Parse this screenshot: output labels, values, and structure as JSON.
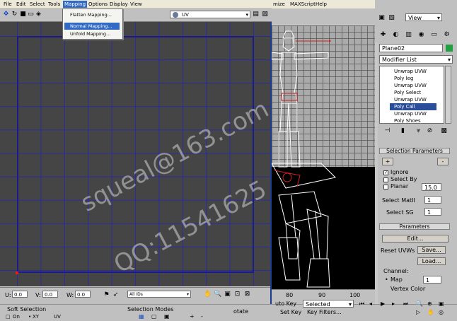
{
  "uv_editor": {
    "menu": [
      "File",
      "Edit",
      "Select",
      "Tools",
      "Mapping",
      "Options",
      "Display",
      "View"
    ],
    "mapping_menu": [
      "Flatten Mapping...",
      "Normal Mapping...",
      "Unfold Mapping..."
    ],
    "highlighted_item": "Normal Mapping...",
    "toolbar_dropdown": "UV",
    "bottom": {
      "u_label": "U:",
      "u_value": "0.0",
      "v_label": "V:",
      "v_value": "0.0",
      "w_label": "W:",
      "w_value": "0.0",
      "id_filter": "All IDs"
    }
  },
  "max_menu": [
    "mize",
    "MAXScript",
    "Help"
  ],
  "viewport_selector": "View",
  "object_name": "Plane02",
  "object_color": "#20a040",
  "modifier_list_label": "Modifier List",
  "modifier_stack": [
    "Unwrap UVW",
    "Poly leg",
    "Unwrap UVW",
    "Poly Select",
    "Unwrap UVW",
    "Poly Call",
    "Unwrap UVW",
    "Poly Shoes"
  ],
  "selected_stack_item": "Poly Call",
  "selection_parameters": {
    "title": "Selection Parameters",
    "ignore": "Ignore",
    "select_by": "Select By",
    "planar": "Planar",
    "planar_value": "15.0",
    "select_matid_label": "Select MatII",
    "select_matid_value": "1",
    "select_sg_label": "Select SG",
    "select_sg_value": "1"
  },
  "parameters": {
    "title": "Parameters",
    "edit_button": "Edit...",
    "reset_uvws": "Reset UVWs",
    "save_button": "Save...",
    "load_button": "Load...",
    "channel_label": "Channel:",
    "map_label": "Map",
    "map_value": "1",
    "vertex_color": "Vertex Color"
  },
  "timeline_ticks": [
    "80",
    "90",
    "100"
  ],
  "bottom_strip": {
    "soft_selection": "Soft Selection",
    "on_label": "On",
    "xy_label": "XY",
    "uv_label": "UV",
    "selection_modes": "Selection Modes",
    "rotate_label": "otate",
    "auto_key": "uto Key",
    "selected": "Selected",
    "set_key": "Set Key",
    "key_filters": "Key Filters..."
  },
  "watermark": [
    "squeal@163.com",
    "QQ:11541625"
  ]
}
